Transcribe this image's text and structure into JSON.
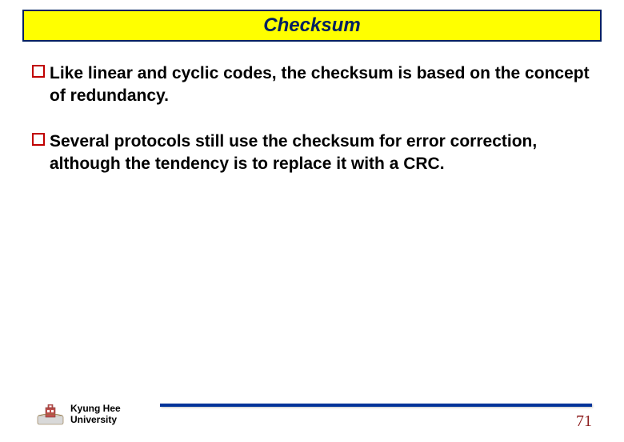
{
  "title": "Checksum",
  "bullets": [
    "Like linear and cyclic codes, the checksum is based on the concept of redundancy.",
    "Several protocols still use the checksum for error correction, although the tendency is to replace it with a CRC."
  ],
  "footer": {
    "org_line1": "Kyung Hee",
    "org_line2": "University",
    "page_number": "71"
  },
  "colors": {
    "title_bg": "#ffff00",
    "title_border": "#002060",
    "title_text": "#002060",
    "bullet_border": "#c00000",
    "rule": "#003399",
    "page_num": "#8b1a1a"
  }
}
